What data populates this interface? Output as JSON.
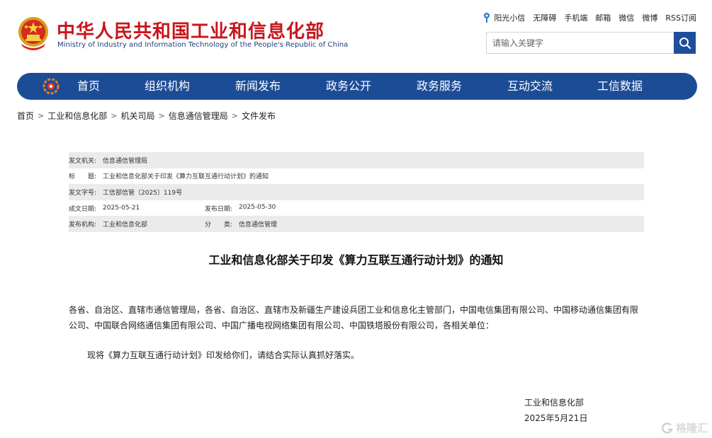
{
  "header": {
    "title": "中华人民共和国工业和信息化部",
    "subtitle": "Ministry of Industry and Information Technology of the People's Republic of China",
    "links": [
      "阳光小信",
      "无障碍",
      "手机端",
      "邮箱",
      "微信",
      "微博",
      "RSS订阅"
    ],
    "search_placeholder": "请输入关键字",
    "colors": {
      "title_red": "#c8161d",
      "nav_blue": "#1d4c97"
    }
  },
  "nav": {
    "items": [
      "首页",
      "组织机构",
      "新闻发布",
      "政务公开",
      "政务服务",
      "互动交流",
      "工信数据"
    ]
  },
  "breadcrumb": [
    "首页",
    "工业和信息化部",
    "机关司局",
    "信息通信管理局",
    "文件发布"
  ],
  "meta": {
    "issuer_label": "发文机关:",
    "issuer": "信息通信管理局",
    "title_label": "标　　题:",
    "title": "工业和信息化部关于印发《算力互联互通行动计划》的通知",
    "docno_label": "发文字号:",
    "docno": "工信部信管〔2025〕119号",
    "date_label": "成文日期:",
    "date": "2025-05-21",
    "pubdate_label": "发布日期:",
    "pubdate": "2025-05-30",
    "org_label": "发布机构:",
    "org": "工业和信息化部",
    "category_label": "分　　类:",
    "category": "信息通信管理"
  },
  "article": {
    "title": "工业和信息化部关于印发《算力互联互通行动计划》的通知",
    "para1": "各省、自治区、直辖市通信管理局，各省、自治区、直辖市及新疆生产建设兵团工业和信息化主管部门，中国电信集团有限公司、中国移动通信集团有限公司、中国联合网络通信集团有限公司、中国广播电视网络集团有限公司、中国铁塔股份有限公司，各相关单位：",
    "para2": "现将《算力互联互通行动计划》印发给你们，请结合实际认真抓好落实。",
    "sign_org": "工业和信息化部",
    "sign_date": "2025年5月21日"
  },
  "watermark": {
    "text": "格隆汇"
  }
}
